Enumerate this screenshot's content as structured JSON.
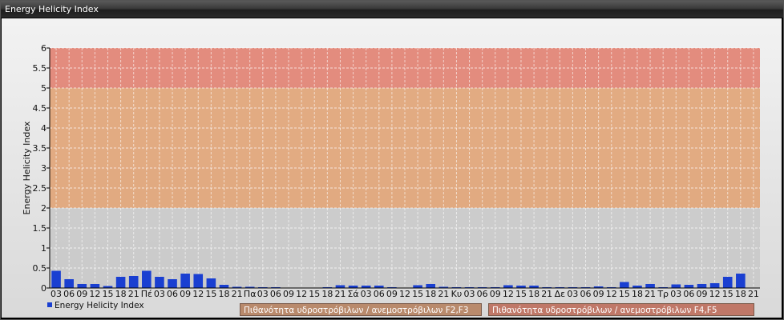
{
  "window": {
    "title": "Energy Helicity Index"
  },
  "colors": {
    "bar": "#1a3fd1",
    "band_red": "#e07a6a",
    "band_orange": "#e0a070",
    "band_gray": "#c8c8c8"
  },
  "chart_data": {
    "type": "bar",
    "ylabel": "Energy Helicity Index",
    "ylim": [
      0,
      6
    ],
    "yticks": [
      "0",
      "0.5",
      "1",
      "1.5",
      "2",
      "2.5",
      "3",
      "3.5",
      "4",
      "4.5",
      "5",
      "5.5",
      "6"
    ],
    "grid": true,
    "bands": [
      {
        "from": 0,
        "to": 2,
        "color": "#c8c8c8"
      },
      {
        "from": 2,
        "to": 5,
        "color": "#e0a070"
      },
      {
        "from": 5,
        "to": 6,
        "color": "#e07a6a"
      }
    ],
    "categories": [
      "03",
      "06",
      "09",
      "12",
      "15",
      "18",
      "21",
      "Πέ",
      "03",
      "06",
      "09",
      "12",
      "15",
      "18",
      "21",
      "Πα",
      "03",
      "06",
      "09",
      "12",
      "15",
      "18",
      "21",
      "Σά",
      "03",
      "06",
      "09",
      "12",
      "15",
      "18",
      "21",
      "Κυ",
      "03",
      "06",
      "09",
      "12",
      "15",
      "18",
      "21",
      "Δε",
      "03",
      "06",
      "09",
      "12",
      "15",
      "18",
      "21",
      "Τρ",
      "03",
      "06",
      "09",
      "12",
      "15",
      "18",
      "21"
    ],
    "series": [
      {
        "name": "Energy Helicity Index",
        "values": [
          0.43,
          0.22,
          0.1,
          0.1,
          0.05,
          0.28,
          0.3,
          0.43,
          0.28,
          0.22,
          0.36,
          0.35,
          0.24,
          0.08,
          0.03,
          0.03,
          0.02,
          0.02,
          0.01,
          0.01,
          0.01,
          0.02,
          0.07,
          0.06,
          0.06,
          0.06,
          0.02,
          0.01,
          0.07,
          0.1,
          0.03,
          0.02,
          0.02,
          0.02,
          0.02,
          0.07,
          0.06,
          0.06,
          0.02,
          0.02,
          0.02,
          0.02,
          0.04,
          0.02,
          0.15,
          0.06,
          0.1,
          0.02,
          0.09,
          0.08,
          0.1,
          0.12,
          0.28,
          0.36
        ]
      }
    ],
    "legend": [
      "Energy Helicity Index",
      "Πιθανότητα υδροστρόβιλων / ανεμοστρόβιλων F2,F3",
      "Πιθανότητα υδροστρόβιλων / ανεμοστρόβιλων F4,F5"
    ]
  }
}
